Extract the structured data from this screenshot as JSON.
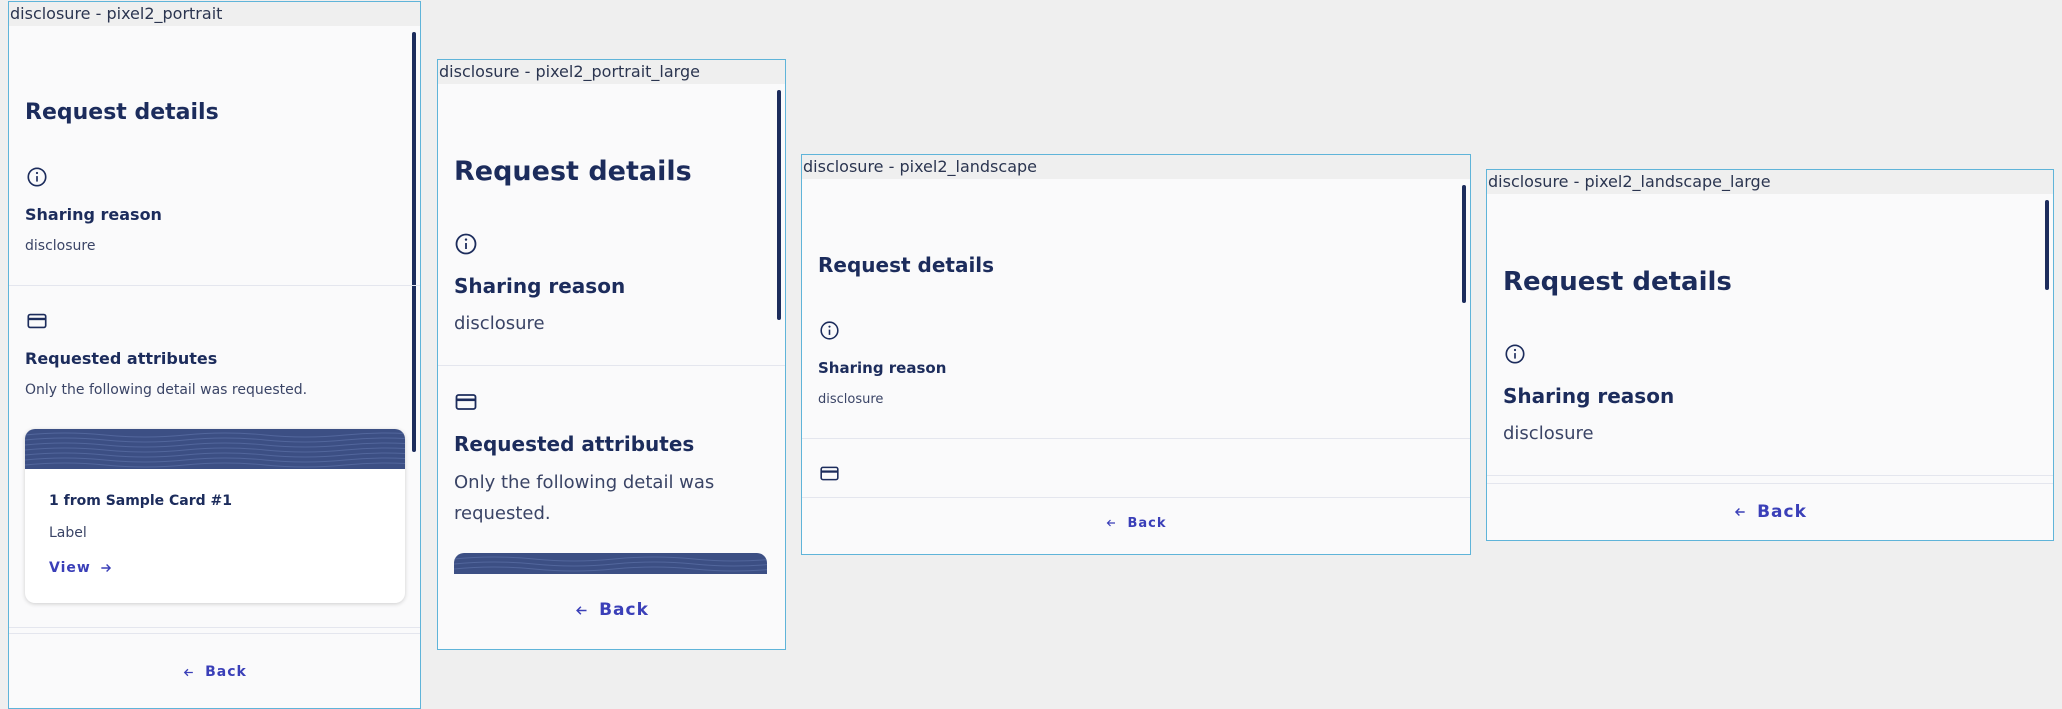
{
  "frames": {
    "f1": {
      "label": "disclosure - pixel2_portrait",
      "title": "Request details",
      "reason_heading": "Sharing reason",
      "reason_value": "disclosure",
      "attributes_heading": "Requested attributes",
      "attributes_desc": "Only the following detail was requested.",
      "card_title": "1 from Sample Card #1",
      "card_label": "Label",
      "card_link": "View",
      "back": "Back"
    },
    "f2": {
      "label": "disclosure - pixel2_portrait_large",
      "title": "Request details",
      "reason_heading": "Sharing reason",
      "reason_value": "disclosure",
      "attributes_heading": "Requested attributes",
      "attributes_desc_line1": "Only the following detail was",
      "attributes_desc_line2": "requested.",
      "back": "Back"
    },
    "f3": {
      "label": "disclosure - pixel2_landscape",
      "title": "Request details",
      "reason_heading": "Sharing reason",
      "reason_value": "disclosure",
      "back": "Back"
    },
    "f4": {
      "label": "disclosure - pixel2_landscape_large",
      "title": "Request details",
      "reason_heading": "Sharing reason",
      "reason_value": "disclosure",
      "back": "Back"
    }
  },
  "icons": {
    "info": "info-circle",
    "card": "credit-card",
    "back_arrow": "arrow-left",
    "view_arrow": "arrow-right"
  },
  "colors": {
    "text": "#1c2c5c",
    "link": "#3a3fb8",
    "card_banner": "#3c4f84",
    "frame_border": "#5fb4d9"
  }
}
